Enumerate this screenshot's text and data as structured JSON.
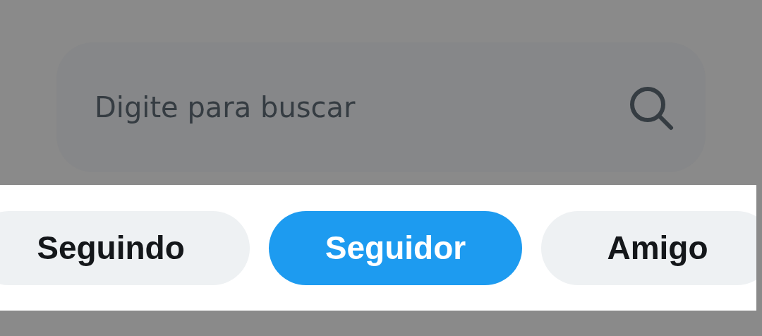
{
  "search": {
    "placeholder": "Digite para buscar"
  },
  "tabs": [
    {
      "label": "Seguindo",
      "selected": false
    },
    {
      "label": "Seguidor",
      "selected": true
    },
    {
      "label": "Amigo",
      "selected": false
    }
  ]
}
